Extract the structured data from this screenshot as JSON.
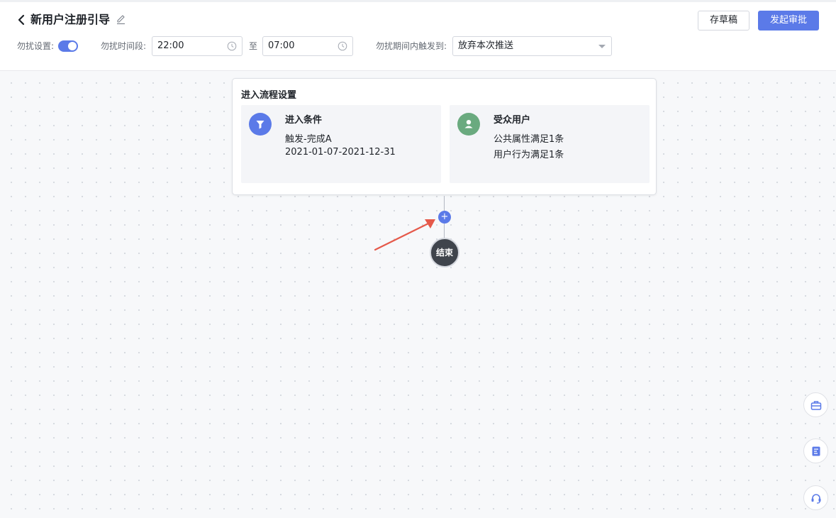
{
  "header": {
    "title": "新用户注册引导",
    "draft_label": "存草稿",
    "submit_label": "发起审批"
  },
  "settings": {
    "dnd_label": "勿扰设置:",
    "dnd_enabled": true,
    "period_label": "勿扰时间段:",
    "start_time": "22:00",
    "to_label": "至",
    "end_time": "07:00",
    "trigger_label": "勿扰期间内触发到:",
    "trigger_value": "放弃本次推送"
  },
  "flow": {
    "card_title": "进入流程设置",
    "entry": {
      "title": "进入条件",
      "line1": "触发-完成A",
      "line2": "2021-01-07-2021-12-31",
      "icon": "filter-icon"
    },
    "audience": {
      "title": "受众用户",
      "line1": "公共属性满足1条",
      "line2": "用户行为满足1条",
      "icon": "user-icon"
    },
    "add_symbol": "+",
    "end_label": "结束"
  },
  "side_tools": [
    "toolbox-icon",
    "document-icon",
    "headset-icon"
  ],
  "colors": {
    "accent": "#5b7ae8",
    "audience_icon": "#6aaa7f",
    "end_node": "#3f444c",
    "annotation_arrow": "#e5594a"
  }
}
